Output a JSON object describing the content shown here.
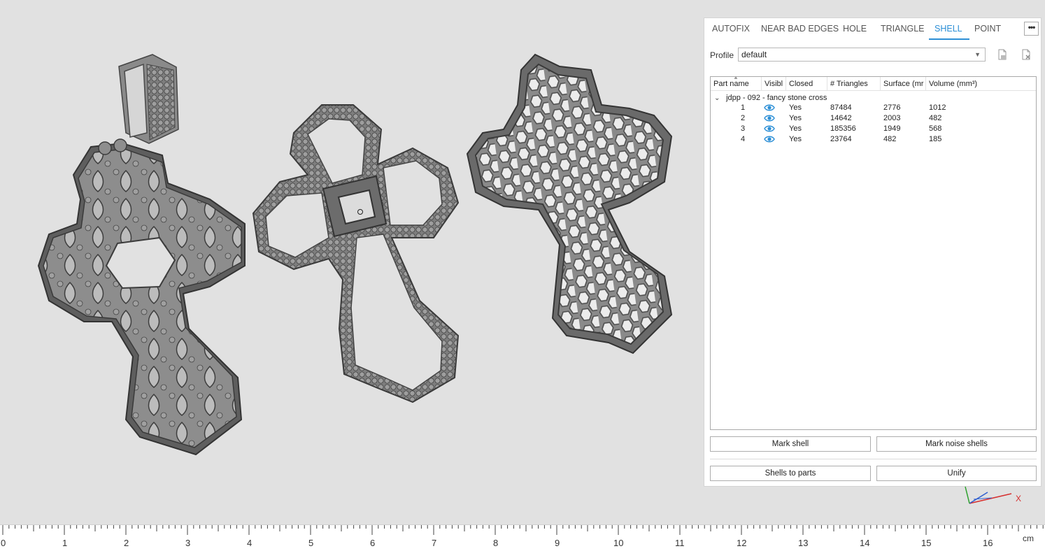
{
  "tabs": [
    {
      "label": "AUTOFIX",
      "active": false
    },
    {
      "label": "NEAR BAD EDGES",
      "active": false
    },
    {
      "label": "HOLE",
      "active": false
    },
    {
      "label": "TRIANGLE",
      "active": false
    },
    {
      "label": "SHELL",
      "active": true
    },
    {
      "label": "POINT",
      "active": false
    }
  ],
  "more_button": "•••",
  "profile": {
    "label": "Profile",
    "value": "default"
  },
  "table": {
    "columns": [
      "Part name",
      "Visibl",
      "Closed",
      "# Triangles",
      "Surface (mr",
      "Volume (mm³)"
    ],
    "group": "jdpp - 092 - fancy stone cross",
    "rows": [
      {
        "name": "1",
        "closed": "Yes",
        "triangles": "87484",
        "surface": "2776",
        "volume": "1012"
      },
      {
        "name": "2",
        "closed": "Yes",
        "triangles": "14642",
        "surface": "2003",
        "volume": "482"
      },
      {
        "name": "3",
        "closed": "Yes",
        "triangles": "185356",
        "surface": "1949",
        "volume": "568"
      },
      {
        "name": "4",
        "closed": "Yes",
        "triangles": "23764",
        "surface": "482",
        "volume": "185"
      }
    ]
  },
  "buttons": {
    "mark_shell": "Mark shell",
    "mark_noise_shells": "Mark noise shells",
    "shells_to_parts": "Shells to parts",
    "unify": "Unify"
  },
  "ruler": {
    "labels": [
      "0",
      "1",
      "2",
      "3",
      "4",
      "5",
      "6",
      "7",
      "8",
      "9",
      "10",
      "11",
      "12",
      "13",
      "14",
      "15",
      "16"
    ],
    "unit": "cm"
  },
  "axis_label": "X",
  "colors": {
    "accent": "#2c8fd6",
    "model": "#8e8e8e",
    "background": "#e1e1e1"
  }
}
